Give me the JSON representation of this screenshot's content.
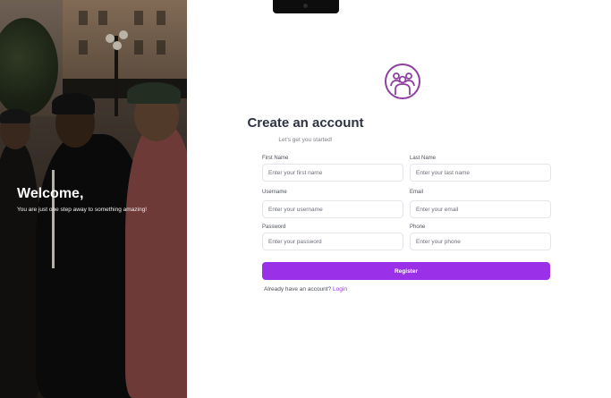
{
  "hero": {
    "title": "Welcome,",
    "subtitle": "You are just one step away to something amazing!"
  },
  "form": {
    "title": "Create an account",
    "subtitle": "Let's get you started!",
    "fields": {
      "first_name": {
        "label": "First Name",
        "placeholder": "Enter your first name"
      },
      "last_name": {
        "label": "Last Name",
        "placeholder": "Enter your last name"
      },
      "username": {
        "label": "Username",
        "placeholder": "Enter your username"
      },
      "email": {
        "label": "Email",
        "placeholder": "Enter your email"
      },
      "password": {
        "label": "Password",
        "placeholder": "Enter your password"
      },
      "phone": {
        "label": "Phone",
        "placeholder": "Enter your phone"
      }
    },
    "register_label": "Register",
    "login_prompt": "Already have an account?",
    "login_link": "Login"
  },
  "icons": {
    "logo": "group-users-icon"
  },
  "colors": {
    "accent": "#9b30e9",
    "logo": "#8e3fa0",
    "title": "#2d3340"
  }
}
